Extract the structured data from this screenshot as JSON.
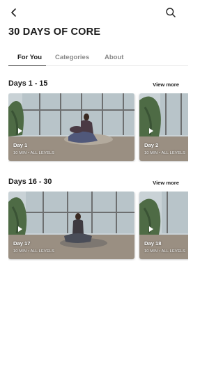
{
  "header": {
    "title": "30 DAYS OF CORE"
  },
  "icons": {
    "back": "chevron-left-icon",
    "search": "search-icon",
    "play": "play-icon"
  },
  "tabs": [
    {
      "label": "For You",
      "active": true
    },
    {
      "label": "Categories",
      "active": false
    },
    {
      "label": "About",
      "active": false
    }
  ],
  "sections": [
    {
      "title": "Days 1 - 15",
      "view_more": "View more",
      "cards": [
        {
          "day": "Day 1",
          "meta": "10 MIN • ALL LEVELS"
        },
        {
          "day": "Day 2",
          "meta": "10 MIN • ALL LEVELS"
        }
      ]
    },
    {
      "title": "Days 16 - 30",
      "view_more": "View more",
      "cards": [
        {
          "day": "Day 17",
          "meta": "10 MIN • ALL LEVELS"
        },
        {
          "day": "Day 18",
          "meta": "10 MIN • ALL LEVELS"
        }
      ]
    }
  ]
}
